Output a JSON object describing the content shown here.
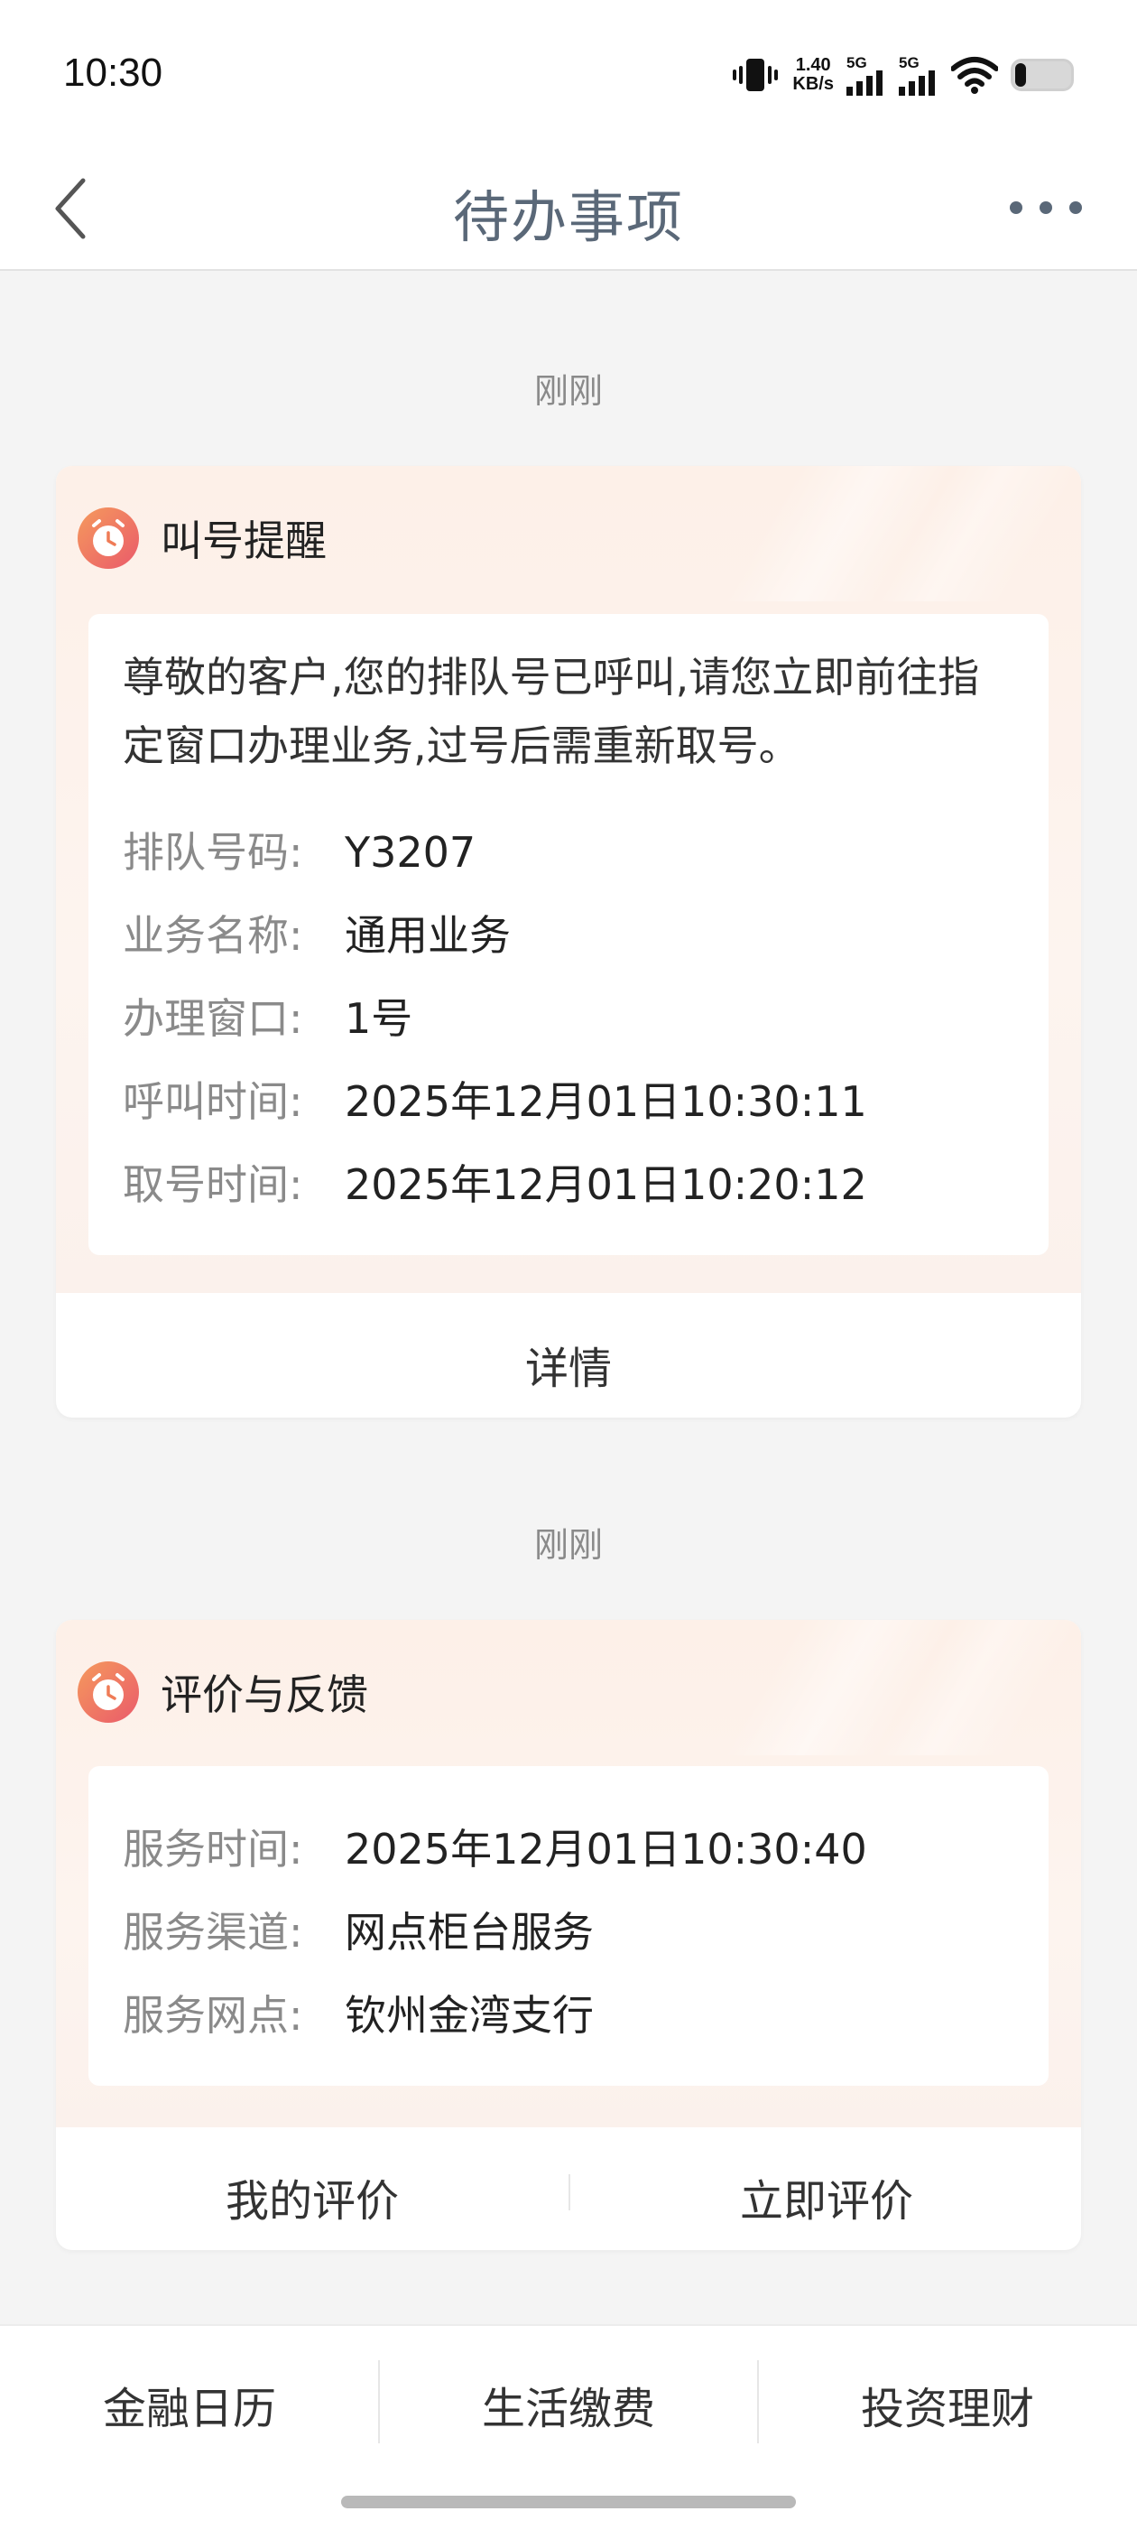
{
  "status_bar": {
    "time": "10:30",
    "net_speed_value": "1.40",
    "net_speed_unit": "KB/s",
    "sim1_label": "5G",
    "sim2_label": "5G",
    "icons": [
      "vibrate-icon",
      "signal-icon",
      "signal-icon",
      "wifi-icon",
      "battery-icon"
    ]
  },
  "nav": {
    "title": "待办事项",
    "back_icon": "chevron-left-icon",
    "more_icon": "more-dots-icon"
  },
  "cards": [
    {
      "time_label": "刚刚",
      "title": "叫号提醒",
      "icon": "clock-icon",
      "notice": "尊敬的客户,您的排队号已呼叫,请您立即前往指定窗口办理业务,过号后需重新取号。",
      "fields": [
        {
          "label": "排队号码:",
          "value": "Y3207"
        },
        {
          "label": "业务名称:",
          "value": "通用业务"
        },
        {
          "label": "办理窗口:",
          "value": "1号"
        },
        {
          "label": "呼叫时间:",
          "value": "2025年12月01日10:30:11"
        },
        {
          "label": "取号时间:",
          "value": "2025年12月01日10:20:12"
        }
      ],
      "action": "详情"
    },
    {
      "time_label": "刚刚",
      "title": "评价与反馈",
      "icon": "clock-icon",
      "fields": [
        {
          "label": "服务时间:",
          "value": "2025年12月01日10:30:40"
        },
        {
          "label": "服务渠道:",
          "value": "网点柜台服务"
        },
        {
          "label": "服务网点:",
          "value": "钦州金湾支行"
        }
      ],
      "actions": [
        "我的评价",
        "立即评价"
      ]
    }
  ],
  "bottom_nav": [
    "金融日历",
    "生活缴费",
    "投资理财"
  ],
  "colors": {
    "accent_orange": "#ef7b56",
    "title_gray_blue": "#5a6878",
    "label_gray": "#8a8a8a",
    "card_header_bg": "#fdf0e8"
  }
}
